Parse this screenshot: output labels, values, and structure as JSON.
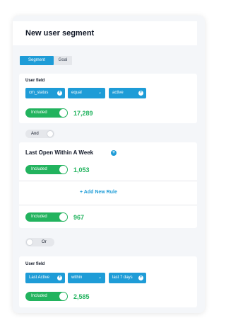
{
  "header": {
    "title": "New user segment"
  },
  "tabs": [
    {
      "label": "Segment"
    },
    {
      "label": "Goal"
    }
  ],
  "group1": {
    "field_label": "User field",
    "attribute": "cm_status",
    "operator": "equal",
    "value": "active",
    "toggle_label": "Included",
    "count": "17,289"
  },
  "connector_and": {
    "label": "And"
  },
  "group2": {
    "rule_title": "Last Open Within A Week",
    "toggle_label": "Included",
    "count": "1,053",
    "add_rule_label": "+ Add New Rule",
    "total_toggle_label": "Included",
    "total_count": "967"
  },
  "connector_or": {
    "label": "Or"
  },
  "group3": {
    "field_label": "User field",
    "attribute": "Last Active",
    "operator": "within",
    "value": "last 7 days",
    "toggle_label": "Included",
    "count": "2,585"
  },
  "colors": {
    "accent": "#1e9cd7",
    "success": "#22b35e",
    "panel_bg": "#f4f6f9"
  },
  "icons": {
    "add": "plus-circle-icon",
    "dropdown": "chevron-down-icon"
  }
}
